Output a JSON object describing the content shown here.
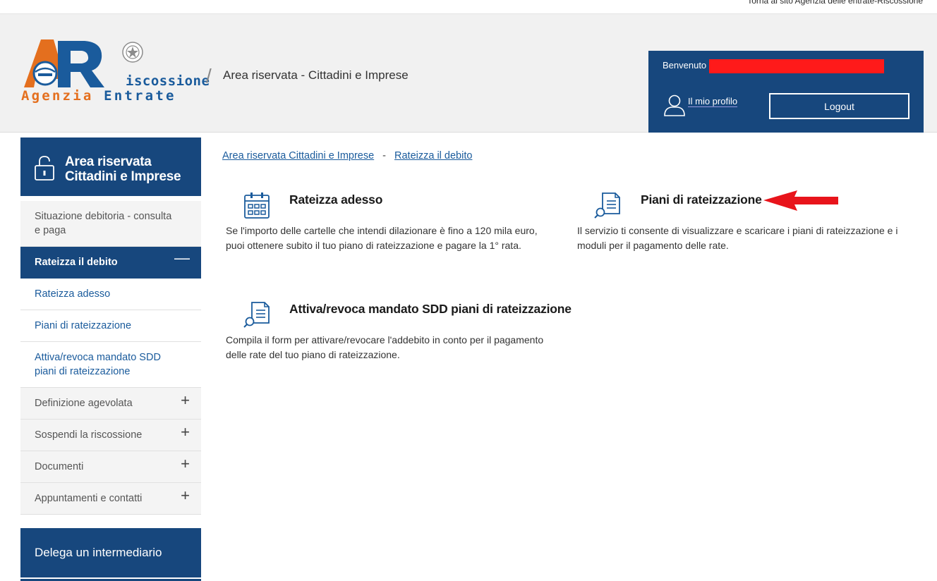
{
  "top_link": "Torna al sito Agenzia delle entrate-Riscossione",
  "logo": {
    "riscossione": "iscossione",
    "agenzia": "Agenzia",
    "entrate": "Entrate"
  },
  "header": {
    "title": "Area riservata - Cittadini e Imprese",
    "welcome": "Benvenuto",
    "profile_label": "Il mio profilo",
    "logout_label": "Logout"
  },
  "sidebar": {
    "head_title_1": "Area riservata",
    "head_title_2": "Cittadini e Imprese",
    "items": [
      {
        "label": "Situazione debitoria - consulta e paga"
      },
      {
        "label": "Rateizza il debito",
        "toggle": "—"
      },
      {
        "label": "Rateizza adesso"
      },
      {
        "label": "Piani di rateizzazione"
      },
      {
        "label": "Attiva/revoca mandato SDD piani di rateizzazione"
      },
      {
        "label": "Definizione agevolata",
        "toggle": "+"
      },
      {
        "label": "Sospendi la riscossione",
        "toggle": "+"
      },
      {
        "label": "Documenti",
        "toggle": "+"
      },
      {
        "label": "Appuntamenti e contatti",
        "toggle": "+"
      }
    ],
    "delega": "Delega un intermediario"
  },
  "breadcrumb": {
    "item1": "Area riservata Cittadini e Imprese",
    "sep": "-",
    "item2": "Rateizza il debito"
  },
  "cards": [
    {
      "icon": "calendar-icon",
      "title": "Rateizza adesso",
      "desc": "Se l'importo delle cartelle che intendi dilazionare è fino a 120 mila euro, puoi ottenere subito il tuo piano di rateizzazione e pagare la 1° rata."
    },
    {
      "icon": "document-search-icon",
      "title": "Piani di rateizzazione",
      "desc": "Il servizio ti consente di visualizzare e scaricare i piani di rateizzazione e i moduli per il pagamento delle rate."
    },
    {
      "icon": "document-search-icon",
      "title": "Attiva/revoca mandato SDD piani di rateizzazione",
      "desc": "Compila il form per attivare/revocare l'addebito in conto per il pagamento delle rate del tuo piano di rateizzazione."
    }
  ],
  "colors": {
    "brand_blue": "#17477d",
    "link_blue": "#1a5b9c",
    "logo_orange": "#e46f1e",
    "annotation_red": "#e8141b"
  }
}
